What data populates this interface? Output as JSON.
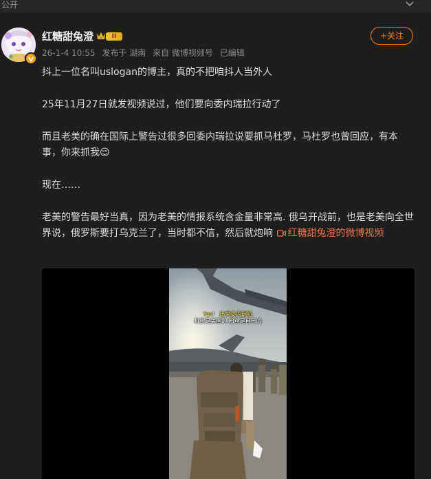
{
  "top": {
    "visibility": "公开"
  },
  "author": {
    "name": "红糖甜兔澄",
    "level": "II",
    "timestamp": "26-1-4 10:55",
    "location": "发布于 湖南",
    "source": "来自 微博视频号",
    "edited": "已编辑",
    "follow_label": "+关注"
  },
  "post": {
    "line1": "抖上一位名叫uslogan的博主，真的不把咱抖人当外人",
    "line2": "25年11月27日就发视频说过，他们要向委内瑞拉行动了",
    "line3": "而且老美的确在国际上警告过很多回委内瑞拉说要抓马杜罗，马杜罗也曾回应，有本事，你来抓我",
    "emoji": "😌",
    "line4": "现在……",
    "line5": "老美的警告最好当真，因为老美的情报系统含金量非常高. 俄乌开战前，也是老美向全世界说，俄罗斯要打乌克兰了，当时都不信，然后就炮响",
    "video_link": "红糖甜兔澄的微博视频"
  },
  "video": {
    "subtitle_line1": "Yes！ 出来委内瑞拉",
    "subtitle_line2": "机密是美国的 粉丝是自己的"
  },
  "colors": {
    "background": "#1e1e1e",
    "accent": "#ff8200",
    "link": "#eb7350",
    "text": "#dcdcdc",
    "meta": "#8c8c8c"
  },
  "icons": [
    "chevron-down-icon",
    "crown-icon",
    "verified-badge-icon",
    "video-camera-icon"
  ]
}
